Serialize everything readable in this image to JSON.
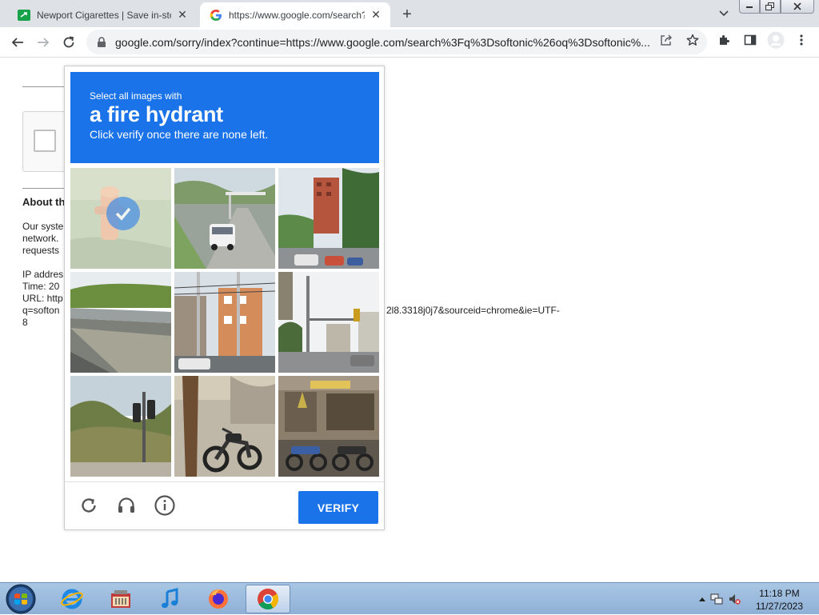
{
  "browser": {
    "tabs": [
      {
        "title": "Newport Cigarettes | Save in-sto",
        "active": false,
        "favicon": "newport-favicon"
      },
      {
        "title": "https://www.google.com/search?",
        "active": true,
        "favicon": "google-favicon"
      }
    ],
    "url": "google.com/sorry/index?continue=https://www.google.com/search%3Fq%3Dsoftonic%26oq%3Dsoftonic%..."
  },
  "page": {
    "about_title": "About th",
    "lines": [
      "Our syste",
      "network.",
      "requests",
      "",
      "IP addres",
      "Time: 20",
      "URL: http",
      "q=softon",
      "8"
    ],
    "url_tail": "2l8.3318j0j7&sourceid=chrome&ie=UTF-"
  },
  "challenge": {
    "instruction_small": "Select all images with",
    "target": "a fire hydrant",
    "instruction_sub": "Click verify once there are none left.",
    "tiles": [
      {
        "content": "fire hydrant in grass",
        "selected": true
      },
      {
        "content": "road with white van",
        "selected": false
      },
      {
        "content": "street with red building and cars",
        "selected": false
      },
      {
        "content": "highway overpass",
        "selected": false
      },
      {
        "content": "buildings with power lines",
        "selected": false
      },
      {
        "content": "street corner with traffic light",
        "selected": false
      },
      {
        "content": "traffic light in shrubs",
        "selected": false
      },
      {
        "content": "motorcycle by tree",
        "selected": false
      },
      {
        "content": "parked motorcycles at storefront",
        "selected": false
      }
    ],
    "verify_label": "VERIFY",
    "footer_icons": [
      "reload-icon",
      "audio-headphones-icon",
      "info-icon"
    ]
  },
  "taskbar": {
    "apps": [
      "internet-explorer-icon",
      "media-center-icon",
      "itunes-icon",
      "firefox-icon",
      "chrome-icon"
    ],
    "time": "11:18 PM",
    "date": "11/27/2023"
  },
  "colors": {
    "accent": "#1a73e8",
    "tab_bar": "#dee1e6"
  }
}
